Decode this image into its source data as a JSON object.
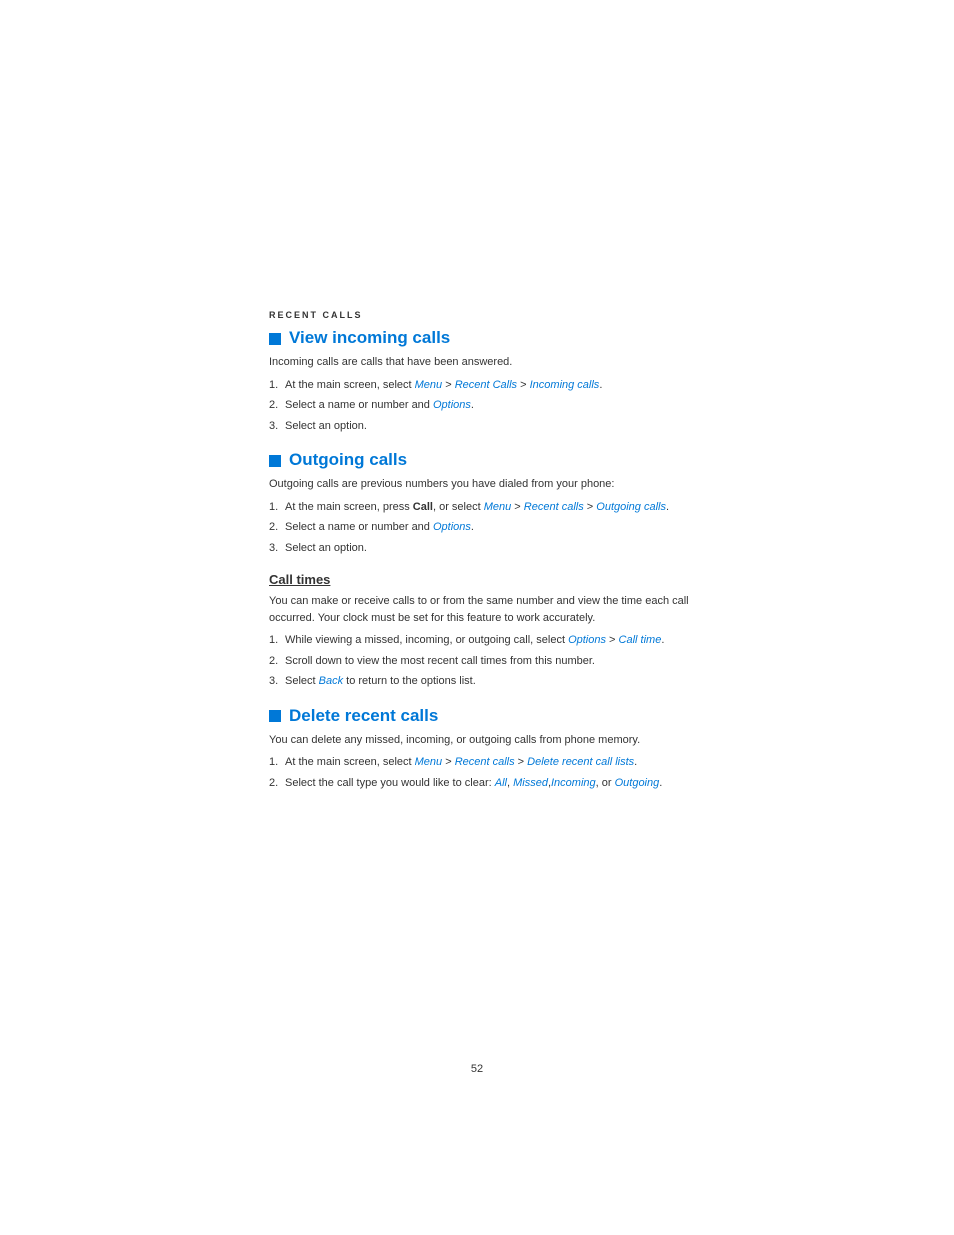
{
  "page": {
    "number": "52",
    "background_color": "#ffffff"
  },
  "section_label": "Recent calls",
  "sections": [
    {
      "id": "view-incoming-calls",
      "type": "blue-heading",
      "heading": "View incoming calls",
      "description": "Incoming calls are calls that have been answered.",
      "steps": [
        {
          "num": "1",
          "text_parts": [
            {
              "text": "At the main screen, select ",
              "style": "normal"
            },
            {
              "text": "Menu",
              "style": "link"
            },
            {
              "text": " > ",
              "style": "normal"
            },
            {
              "text": "Recent Calls",
              "style": "link"
            },
            {
              "text": " > ",
              "style": "normal"
            },
            {
              "text": "Incoming calls",
              "style": "link"
            },
            {
              "text": ".",
              "style": "normal"
            }
          ]
        },
        {
          "num": "2",
          "text_parts": [
            {
              "text": "Select a name or number and ",
              "style": "normal"
            },
            {
              "text": "Options",
              "style": "link"
            },
            {
              "text": ".",
              "style": "normal"
            }
          ]
        },
        {
          "num": "3",
          "text_parts": [
            {
              "text": "Select an option.",
              "style": "normal"
            }
          ]
        }
      ]
    },
    {
      "id": "outgoing-calls",
      "type": "blue-heading",
      "heading": "Outgoing calls",
      "description": "Outgoing calls are previous numbers you have dialed from your phone:",
      "steps": [
        {
          "num": "1",
          "text_parts": [
            {
              "text": "At the main screen, press ",
              "style": "normal"
            },
            {
              "text": "Call",
              "style": "bold"
            },
            {
              "text": ", or select ",
              "style": "normal"
            },
            {
              "text": "Menu",
              "style": "link"
            },
            {
              "text": " > ",
              "style": "normal"
            },
            {
              "text": "Recent calls",
              "style": "link"
            },
            {
              "text": " > ",
              "style": "normal"
            },
            {
              "text": "Outgoing calls",
              "style": "link"
            },
            {
              "text": ".",
              "style": "normal"
            }
          ]
        },
        {
          "num": "2",
          "text_parts": [
            {
              "text": "Select a name or number and ",
              "style": "normal"
            },
            {
              "text": "Options",
              "style": "link"
            },
            {
              "text": ".",
              "style": "normal"
            }
          ]
        },
        {
          "num": "3",
          "text_parts": [
            {
              "text": "Select an option.",
              "style": "normal"
            }
          ]
        }
      ]
    },
    {
      "id": "call-times",
      "type": "underline-heading",
      "heading": "Call times",
      "description1": "You can make or receive calls to or from the same number and view the time each call occurred. Your clock must be set for this feature to work accurately.",
      "steps": [
        {
          "num": "1",
          "text_parts": [
            {
              "text": "While viewing a missed, incoming, or outgoing call, select ",
              "style": "normal"
            },
            {
              "text": "Options",
              "style": "link"
            },
            {
              "text": " > ",
              "style": "normal"
            },
            {
              "text": "Call time",
              "style": "link"
            },
            {
              "text": ".",
              "style": "normal"
            }
          ]
        },
        {
          "num": "2",
          "text_parts": [
            {
              "text": "Scroll down to view the most recent call times from this number.",
              "style": "normal"
            }
          ]
        },
        {
          "num": "3",
          "text_parts": [
            {
              "text": "Select ",
              "style": "normal"
            },
            {
              "text": "Back",
              "style": "link"
            },
            {
              "text": " to return to the options list.",
              "style": "normal"
            }
          ]
        }
      ]
    },
    {
      "id": "delete-recent-calls",
      "type": "blue-heading",
      "heading": "Delete recent calls",
      "description": "You can delete any missed, incoming, or outgoing calls from phone memory.",
      "steps": [
        {
          "num": "1",
          "text_parts": [
            {
              "text": "At the main screen, select ",
              "style": "normal"
            },
            {
              "text": "Menu",
              "style": "link"
            },
            {
              "text": " > ",
              "style": "normal"
            },
            {
              "text": "Recent calls",
              "style": "link"
            },
            {
              "text": " > ",
              "style": "normal"
            },
            {
              "text": "Delete recent call lists",
              "style": "link"
            },
            {
              "text": ".",
              "style": "normal"
            }
          ]
        },
        {
          "num": "2",
          "text_parts": [
            {
              "text": "Select the call type you would like to clear: ",
              "style": "normal"
            },
            {
              "text": "All",
              "style": "link"
            },
            {
              "text": ", ",
              "style": "normal"
            },
            {
              "text": "Missed",
              "style": "link"
            },
            {
              "text": ",",
              "style": "normal"
            },
            {
              "text": "Incoming",
              "style": "link"
            },
            {
              "text": ", or ",
              "style": "normal"
            },
            {
              "text": "Outgoing",
              "style": "link"
            },
            {
              "text": ".",
              "style": "normal"
            }
          ]
        }
      ]
    }
  ]
}
